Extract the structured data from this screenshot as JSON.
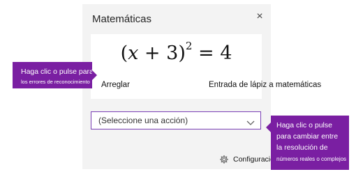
{
  "panel": {
    "title": "Matemáticas",
    "close_symbol": "×",
    "equation": {
      "base": "(𝑥 + 3)",
      "exponent": "2",
      "rhs": "= 4"
    },
    "fix_link": "Arreglar",
    "ink_to_math_link": "Entrada de lápiz a matemáticas",
    "action_select": {
      "value": "(Seleccione una acción)"
    },
    "settings_label": "Configuración"
  },
  "tooltips": {
    "fix": {
      "line1": "Haga clic o pulse para",
      "line2": "los errores de reconocimiento"
    },
    "action": {
      "line1": "Haga clic o pulse",
      "line2": "para cambiar entre",
      "line3": "la resolución de",
      "line4": "números reales o complejos"
    }
  },
  "colors": {
    "accent": "#7a1fa2",
    "select_border": "#7a3fb5",
    "panel_bg": "#f3f3f3"
  },
  "icons": [
    "close-icon",
    "chevron-down-icon",
    "gear-icon"
  ]
}
